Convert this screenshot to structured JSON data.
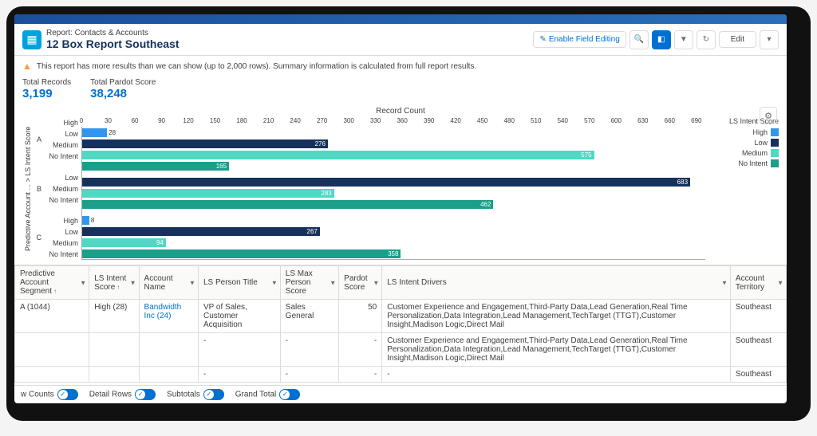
{
  "header": {
    "subtitle": "Report: Contacts & Accounts",
    "title": "12 Box Report Southeast",
    "enable_field_editing": "Enable Field Editing",
    "edit": "Edit"
  },
  "alert": {
    "text": "This report has more results than we can show (up to 2,000 rows). Summary information is calculated from full report results."
  },
  "metrics": {
    "total_records_label": "Total Records",
    "total_records_value": "3,199",
    "total_pardot_label": "Total Pardot Score",
    "total_pardot_value": "38,248"
  },
  "chart_data": {
    "type": "bar",
    "orientation": "horizontal",
    "title": "Record Count",
    "ylabel": "Predictive Account ... > LS Intent Score",
    "x_ticks": [
      0,
      30,
      60,
      90,
      120,
      150,
      180,
      210,
      240,
      270,
      300,
      330,
      360,
      390,
      420,
      450,
      480,
      510,
      540,
      570,
      600,
      630,
      660,
      690
    ],
    "x_max": 700,
    "groups": [
      {
        "group": "A",
        "rows": [
          {
            "category": "High",
            "value": 28,
            "color": "high"
          },
          {
            "category": "Low",
            "value": 276,
            "color": "low"
          },
          {
            "category": "Medium",
            "value": 575,
            "color": "med"
          },
          {
            "category": "No Intent",
            "value": 165,
            "color": "noi"
          }
        ]
      },
      {
        "group": "B",
        "rows": [
          {
            "category": "Low",
            "value": 683,
            "color": "low"
          },
          {
            "category": "Medium",
            "value": 283,
            "color": "med"
          },
          {
            "category": "No Intent",
            "value": 462,
            "color": "noi"
          }
        ]
      },
      {
        "group": "C",
        "rows": [
          {
            "category": "High",
            "value": 8,
            "color": "high"
          },
          {
            "category": "Low",
            "value": 267,
            "color": "low"
          },
          {
            "category": "Medium",
            "value": 94,
            "color": "med"
          },
          {
            "category": "No Intent",
            "value": 358,
            "color": "noi"
          }
        ]
      }
    ],
    "legend": {
      "title": "LS Intent Score",
      "items": [
        {
          "label": "High",
          "color": "high"
        },
        {
          "label": "Low",
          "color": "low"
        },
        {
          "label": "Medium",
          "color": "med"
        },
        {
          "label": "No Intent",
          "color": "noi"
        }
      ]
    }
  },
  "table": {
    "columns": [
      "Predictive Account Segment",
      "LS Intent Score",
      "Account Name",
      "LS Person Title",
      "LS Max Person Score",
      "Pardot Score",
      "LS Intent Drivers",
      "Account Territory"
    ],
    "rows": [
      {
        "seg": "A (1044)",
        "intent": "High (28)",
        "acct": "Bandwidth Inc (24)",
        "title": "VP of Sales, Customer Acquisition",
        "max": "Sales General",
        "pardot": "50",
        "drivers": "Customer Experience and Engagement,Third-Party Data,Lead Generation,Real Time Personalization,Data Integration,Lead Management,TechTarget (TTGT),Customer Insight,Madison Logic,Direct Mail",
        "terr": "Southeast"
      },
      {
        "seg": "",
        "intent": "",
        "acct": "",
        "title": "-",
        "max": "-",
        "pardot": "-",
        "drivers": "Customer Experience and Engagement,Third-Party Data,Lead Generation,Real Time Personalization,Data Integration,Lead Management,TechTarget (TTGT),Customer Insight,Madison Logic,Direct Mail",
        "terr": "Southeast"
      },
      {
        "seg": "",
        "intent": "",
        "acct": "",
        "title": "-",
        "max": "-",
        "pardot": "-",
        "drivers": "-",
        "terr": "Southeast"
      }
    ]
  },
  "footer": {
    "row_counts": "w Counts",
    "detail_rows": "Detail Rows",
    "subtotals": "Subtotals",
    "grand_total": "Grand Total"
  },
  "colors": {
    "high": "#3296ed",
    "low": "#16325c",
    "med": "#4fd8c4",
    "noi": "#1b9e8a"
  }
}
